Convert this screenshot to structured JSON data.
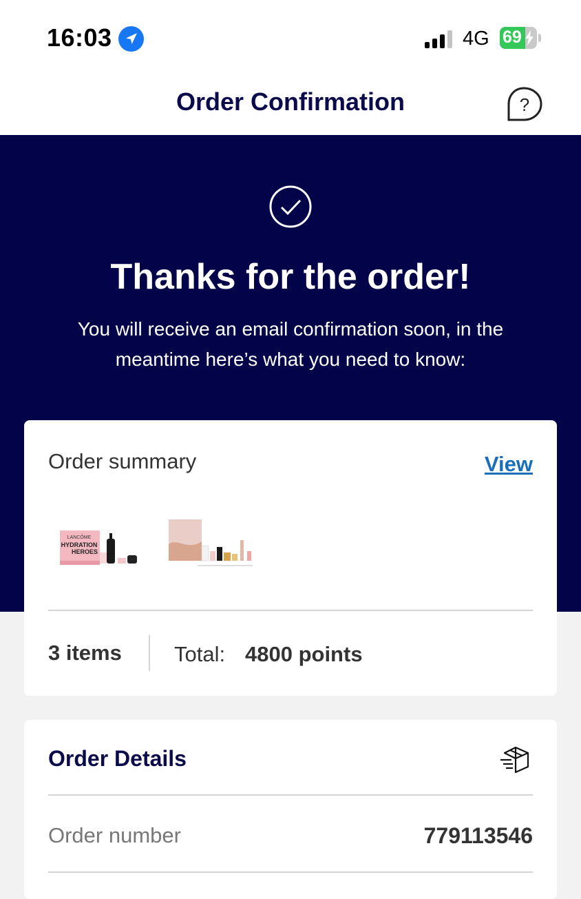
{
  "status_bar": {
    "time": "16:03",
    "network": "4G",
    "battery_percent": "69",
    "battery_level": 0.69,
    "icons": [
      "location-arrow-icon",
      "signal-bars-icon",
      "battery-charging-icon"
    ]
  },
  "nav": {
    "title": "Order Confirmation",
    "help_icon": "question-bubble-icon"
  },
  "hero": {
    "title": "Thanks for the order!",
    "subtitle": "You will receive an email confirmation soon, in the meantime here’s what you need to know:",
    "icon": "check-circle-icon"
  },
  "summary": {
    "label": "Order summary",
    "view_label": "View",
    "product_thumb_1_text": "HYDRATION HEROES",
    "product_thumb_1_brand": "LANCÔME",
    "items_count": "3 items",
    "total_label": "Total:",
    "total_value": "4800 points"
  },
  "details": {
    "title": "Order Details",
    "icon": "delivery-box-icon",
    "order_number_label": "Order number",
    "order_number_value": "779113546"
  },
  "colors": {
    "navy": "#03034a",
    "title_navy": "#0b0a4a",
    "link_blue": "#1a6fb8",
    "battery_green": "#34c759"
  }
}
